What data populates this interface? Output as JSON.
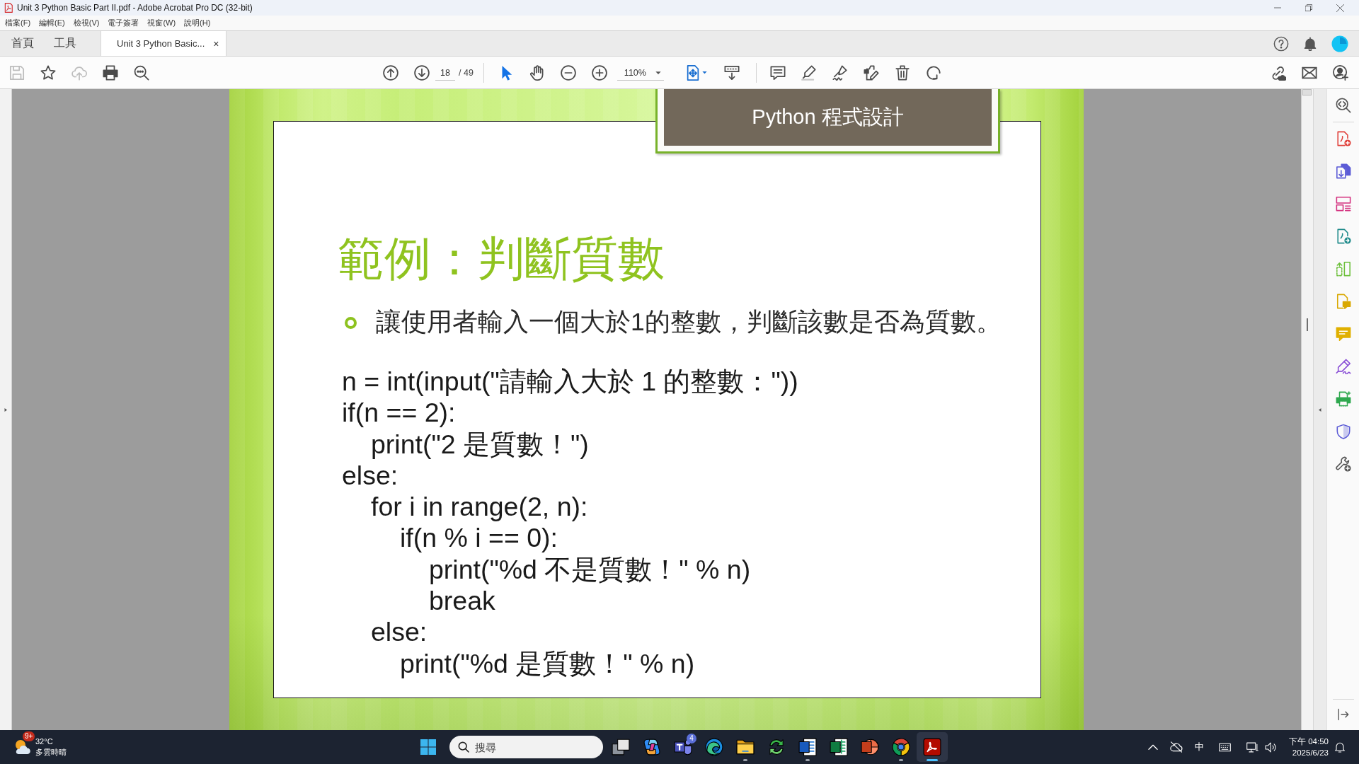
{
  "window": {
    "title": "Unit 3 Python Basic Part II.pdf - Adobe Acrobat Pro DC (32-bit)"
  },
  "menu": [
    "檔案(F)",
    "編輯(E)",
    "檢視(V)",
    "電子簽署",
    "視窗(W)",
    "說明(H)"
  ],
  "tabs": [
    {
      "label": "首頁",
      "selected": false
    },
    {
      "label": "工具",
      "selected": false
    },
    {
      "label": "Unit 3 Python Basic...",
      "selected": true,
      "close": "×"
    }
  ],
  "toolbar": {
    "file_tools": [
      {
        "kind": "save",
        "disabled": true
      },
      {
        "kind": "bookmark",
        "disabled": false
      },
      {
        "kind": "upload",
        "disabled": true
      },
      {
        "kind": "print",
        "disabled": false
      },
      {
        "kind": "find",
        "disabled": false
      }
    ],
    "page": {
      "value": "18",
      "total": "/ 49"
    },
    "modes": [
      {
        "kind": "select",
        "selected": true
      },
      {
        "kind": "hand",
        "selected": false
      }
    ],
    "zoom": {
      "value": "110%"
    }
  },
  "slide": {
    "header": "Python 程式設計",
    "title": "範例：判斷質數",
    "bullets": [
      "讓使用者輸入一個大於1的整數，判斷該數是否為質數。"
    ],
    "code": [
      {
        "text": "n = int(input(\"請輸入大於 1 的整數：\"))"
      },
      {
        "text": "if(n == 2):",
        "children": [
          {
            "text": "print(\"2 是質數！\")"
          }
        ]
      },
      {
        "text": "else:",
        "children": [
          {
            "text": "for i in range(2, n):",
            "children": [
              {
                "text": "if(n % i == 0):",
                "children": [
                  {
                    "text": "print(\"%d 不是質數！\" % n)"
                  },
                  {
                    "text": "break"
                  }
                ]
              }
            ]
          },
          {
            "text": "else:",
            "children": [
              {
                "text": "print(\"%d 是質數！\" % n)"
              }
            ]
          }
        ]
      }
    ]
  },
  "taskbar": {
    "weather": {
      "badge": "9+",
      "temperature": "32°C",
      "condition": "多雲時晴"
    },
    "search": {
      "placeholder": "搜尋"
    },
    "apps": [
      {
        "kind": "task-view",
        "running": false,
        "selected": false
      },
      {
        "kind": "assistant",
        "running": false,
        "selected": false
      },
      {
        "kind": "team-chat",
        "running": false,
        "selected": false,
        "badge": "4"
      },
      {
        "kind": "browser",
        "running": false,
        "selected": false
      },
      {
        "kind": "folder",
        "running": true,
        "selected": false
      },
      {
        "kind": "sync",
        "running": false,
        "selected": false
      },
      {
        "kind": "document",
        "running": true,
        "selected": false
      },
      {
        "kind": "spreadsheet",
        "running": false,
        "selected": false
      },
      {
        "kind": "presentation",
        "running": false,
        "selected": false
      },
      {
        "kind": "circle-browser",
        "running": true,
        "selected": false
      },
      {
        "kind": "pdf",
        "running": true,
        "selected": true
      }
    ],
    "tray": {
      "ime": "中",
      "time": "下午 04:50",
      "date": "2025/6/23"
    }
  }
}
